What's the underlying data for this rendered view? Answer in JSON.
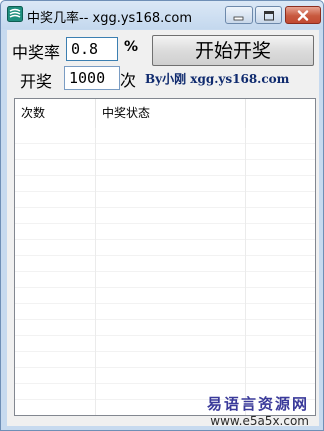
{
  "window": {
    "title": "中奖几率-- xgg.ys168.com"
  },
  "form": {
    "rate_label": "中奖率",
    "rate_value": "0.8",
    "rate_unit": "%",
    "count_label": "开奖",
    "count_value": "1000",
    "count_unit": "次",
    "start_button": "开始开奖",
    "credit": "By小刚 xgg.ys168.com"
  },
  "list": {
    "columns": [
      "次数",
      "中奖状态"
    ],
    "rows": []
  },
  "watermark": {
    "text": "易语言资源网",
    "url": "www.e5a5x.com"
  },
  "colors": {
    "title_bar": "#c4d8ee",
    "close_button": "#c85a3f",
    "credit_text": "#0f2a6e"
  }
}
